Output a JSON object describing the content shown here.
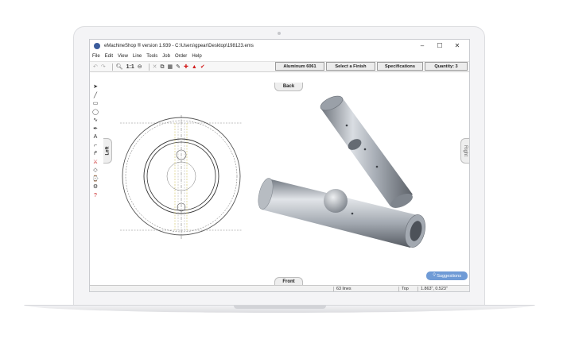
{
  "window": {
    "title": "eMachineShop ® version 1.939 - C:\\Users\\gpear\\Desktop\\198123.ems",
    "controls": {
      "minimize": "–",
      "maximize": "☐",
      "close": "✕"
    }
  },
  "menu": {
    "items": [
      "File",
      "Edit",
      "View",
      "Line",
      "Tools",
      "Job",
      "Order",
      "Help"
    ]
  },
  "toolbar": {
    "scale_label": "1:1"
  },
  "spec_buttons": {
    "material": "Aluminum 6061",
    "finish": "Select a Finish",
    "specifications": "Specifications",
    "quantity": "Quantity: 3"
  },
  "view_tabs": {
    "back": "Back",
    "front": "Front",
    "left": "Left",
    "right": "Right"
  },
  "suggestions": {
    "label": "Suggestions"
  },
  "status": {
    "lines": "63 lines",
    "view": "Top",
    "coordinates": "1.863\", 0.523\""
  },
  "colors": {
    "accent_red": "#d21b1b",
    "suggestions_blue": "#6f9bd6",
    "hidden_line_yellow": "#cfc25a",
    "part_metal": "#a7adb5"
  },
  "icons": {
    "left_tools": [
      "pointer-icon",
      "line-tool-icon",
      "rectangle-tool-icon",
      "circle-tool-icon",
      "spline-tool-icon",
      "pen-tool-icon",
      "text-tool-icon",
      "fillet-tool-icon",
      "bend-tool-icon",
      "knife-tool-icon",
      "eraser-tool-icon",
      "measure-tool-icon",
      "thread-tool-icon",
      "help-tool-icon"
    ]
  }
}
